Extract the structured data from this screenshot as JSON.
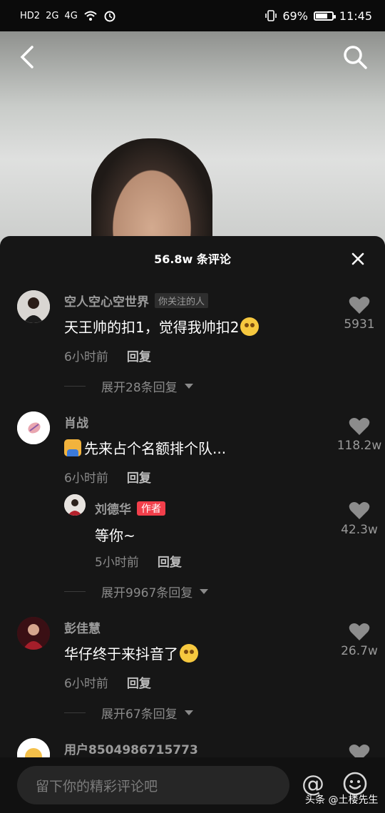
{
  "status_bar": {
    "left_icons": [
      "HD2",
      "2G",
      "4G",
      "wifi-icon",
      "alarm-icon"
    ],
    "battery": "69%",
    "battery_level": 0.69,
    "time": "11:45"
  },
  "sheet": {
    "title": "56.8w 条评论"
  },
  "comments": [
    {
      "username": "空人空心空世界",
      "tag": "你关注的人",
      "text": "天王帅的扣1，觉得我帅扣2",
      "time": "6小时前",
      "reply_label": "回复",
      "likes": "5931",
      "expand": "展开28条回复"
    },
    {
      "username": "肖战",
      "text": "先来占个名额排个队...",
      "time": "6小时前",
      "reply_label": "回复",
      "likes": "118.2w",
      "reply": {
        "username": "刘德华",
        "tag": "作者",
        "text": "等你~",
        "time": "5小时前",
        "reply_label": "回复",
        "likes": "42.3w"
      },
      "expand": "展开9967条回复"
    },
    {
      "username": "彭佳慧",
      "text": "华仔终于来抖音了",
      "time": "6小时前",
      "reply_label": "回复",
      "likes": "26.7w",
      "expand": "展开67条回复"
    },
    {
      "username": "用户8504986715773"
    }
  ],
  "input": {
    "placeholder": "留下你的精彩评论吧"
  },
  "watermark": "头条 @土楼先生",
  "colors": {
    "sheet_bg": "#161616",
    "author_tag": "#f23f4b",
    "text_muted": "#8a8a8a"
  }
}
